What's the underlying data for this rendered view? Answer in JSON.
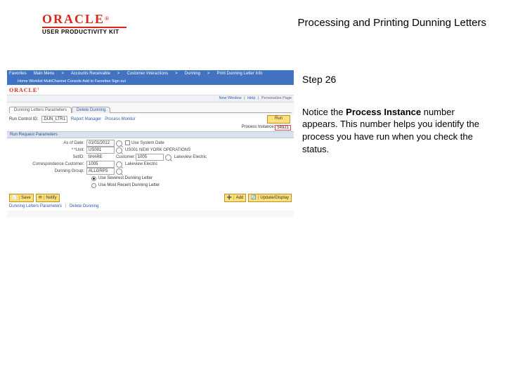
{
  "header": {
    "brand_main": "ORACLE",
    "brand_reg": "®",
    "brand_sub": "USER PRODUCTIVITY KIT",
    "slide_title": "Processing and Printing Dunning Letters"
  },
  "step": {
    "label": "Step 26",
    "instruction_prefix": "Notice the ",
    "instruction_bold": "Process Instance",
    "instruction_suffix": " number appears. This number helps you identify the process you have run when you check the status."
  },
  "app": {
    "topbar_left": [
      "Favorites",
      "Main Menu",
      "Accounts Receivable",
      "Customer Interactions",
      "Dunning",
      "Print Dunning Letter Info"
    ],
    "topbar_right": [
      "Home",
      "Worklist",
      "MultiChannel Console",
      "Add to Favorites",
      "Sign out"
    ],
    "brand": "ORACLE'",
    "newwin_items": [
      "New Window",
      "Help",
      "Personalize Page"
    ],
    "tabs": [
      {
        "label": "Dunning Letters Parameters",
        "active": true
      },
      {
        "label": "Delete Dunning",
        "active": false
      }
    ],
    "runrow": {
      "runcontrol_label": "Run Control ID:",
      "runcontrol_value": "DUN_LTR1",
      "report_manager": "Report Manager",
      "process_monitor": "Process Monitor",
      "run_btn": "Run"
    },
    "process_instance": {
      "label": "Process Instance:",
      "value": "54921"
    },
    "group_header": "Run Request Parameters",
    "fields": {
      "asof_label": "As of Date:",
      "asof_value": "01/01/2012",
      "use_sysdate_label": "Use System Date",
      "unit_label": "*Unit:",
      "unit_value": "US001",
      "unit_desc": "US001 NEW YORK OPERATIONS",
      "setid_label": "SetID:",
      "setid_value": "SHARE",
      "customer_label": "Customer:",
      "customer_value": "1005",
      "customer_desc": "Lakeview Electric",
      "corrgroup_label": "Correspondence Customer:",
      "corrgroup_value": "1005",
      "corrgroup_desc": "Lakeview Electric",
      "dunning_group_label": "Dunning Group:",
      "dunning_group_value": "ALLGRPS",
      "dunning_mag": true
    },
    "radios": {
      "opt1": "Use Severest Dunning Letter",
      "opt2": "Use Most Recent Dunning Letter",
      "selected": 0
    },
    "actions": {
      "save": "Save",
      "notify": "Notify",
      "add": "Add",
      "update": "Update/Display"
    },
    "foot_links": [
      "Dunning Letters Parameters",
      "Delete Dunning"
    ]
  }
}
